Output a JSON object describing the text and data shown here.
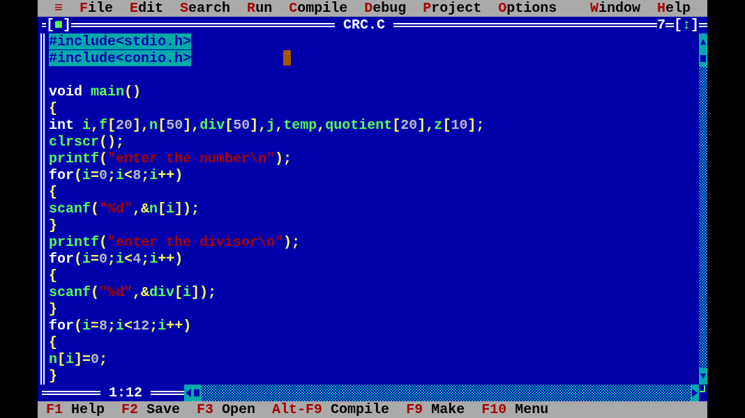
{
  "menu": {
    "items": [
      {
        "label": "≡"
      },
      {
        "label": "File"
      },
      {
        "label": "Edit"
      },
      {
        "label": "Search"
      },
      {
        "label": "Run"
      },
      {
        "label": "Compile"
      },
      {
        "label": "Debug"
      },
      {
        "label": "Project"
      },
      {
        "label": "Options"
      }
    ],
    "right_items": [
      {
        "label": "Window"
      },
      {
        "label": "Help"
      }
    ]
  },
  "window": {
    "close_button": "[■]",
    "title": "CRC.C",
    "number": "7",
    "zoom_button": "[↕]",
    "position": "1:12"
  },
  "editor": {
    "lines": [
      {
        "selected": true,
        "tokens": [
          {
            "kind": "preproc",
            "text": "#include<stdio.h>"
          }
        ]
      },
      {
        "selected": true,
        "tokens": [
          {
            "kind": "preproc",
            "text": "#include<conio.h>"
          }
        ]
      },
      {
        "selected": false
      },
      {
        "selected": false,
        "tokens": [
          {
            "kind": "keyword",
            "text": "void "
          },
          {
            "kind": "ident",
            "text": "main"
          },
          {
            "kind": "punct",
            "text": "()"
          }
        ]
      },
      {
        "selected": false,
        "tokens": [
          {
            "kind": "punct",
            "text": "{"
          }
        ]
      },
      {
        "selected": false,
        "tokens": [
          {
            "kind": "keyword",
            "text": "int "
          },
          {
            "kind": "ident",
            "text": "i"
          },
          {
            "kind": "punct",
            "text": ","
          },
          {
            "kind": "ident",
            "text": "f"
          },
          {
            "kind": "punct",
            "text": "["
          },
          {
            "kind": "number",
            "text": "20"
          },
          {
            "kind": "punct",
            "text": "],"
          },
          {
            "kind": "ident",
            "text": "n"
          },
          {
            "kind": "punct",
            "text": "["
          },
          {
            "kind": "number",
            "text": "50"
          },
          {
            "kind": "punct",
            "text": "],"
          },
          {
            "kind": "ident",
            "text": "div"
          },
          {
            "kind": "punct",
            "text": "["
          },
          {
            "kind": "number",
            "text": "50"
          },
          {
            "kind": "punct",
            "text": "],"
          },
          {
            "kind": "ident",
            "text": "j"
          },
          {
            "kind": "punct",
            "text": ","
          },
          {
            "kind": "ident",
            "text": "temp"
          },
          {
            "kind": "punct",
            "text": ","
          },
          {
            "kind": "ident",
            "text": "quotient"
          },
          {
            "kind": "punct",
            "text": "["
          },
          {
            "kind": "number",
            "text": "20"
          },
          {
            "kind": "punct",
            "text": "],"
          },
          {
            "kind": "ident",
            "text": "z"
          },
          {
            "kind": "punct",
            "text": "["
          },
          {
            "kind": "number",
            "text": "10"
          },
          {
            "kind": "punct",
            "text": "];"
          }
        ]
      },
      {
        "selected": false,
        "tokens": [
          {
            "kind": "ident",
            "text": "clrscr"
          },
          {
            "kind": "punct",
            "text": "();"
          }
        ]
      },
      {
        "selected": false,
        "tokens": [
          {
            "kind": "ident",
            "text": "printf"
          },
          {
            "kind": "punct",
            "text": "("
          },
          {
            "kind": "string",
            "text": "\"enter the number\\n\""
          },
          {
            "kind": "punct",
            "text": ");"
          }
        ]
      },
      {
        "selected": false,
        "tokens": [
          {
            "kind": "keyword",
            "text": "for"
          },
          {
            "kind": "punct",
            "text": "("
          },
          {
            "kind": "ident",
            "text": "i"
          },
          {
            "kind": "punct",
            "text": "="
          },
          {
            "kind": "number",
            "text": "0"
          },
          {
            "kind": "punct",
            "text": ";"
          },
          {
            "kind": "ident",
            "text": "i"
          },
          {
            "kind": "punct",
            "text": "<"
          },
          {
            "kind": "number",
            "text": "8"
          },
          {
            "kind": "punct",
            "text": ";"
          },
          {
            "kind": "ident",
            "text": "i"
          },
          {
            "kind": "punct",
            "text": "++)"
          }
        ]
      },
      {
        "selected": false,
        "tokens": [
          {
            "kind": "punct",
            "text": "{"
          }
        ]
      },
      {
        "selected": false,
        "tokens": [
          {
            "kind": "ident",
            "text": "scanf"
          },
          {
            "kind": "punct",
            "text": "("
          },
          {
            "kind": "string",
            "text": "\"%d\""
          },
          {
            "kind": "punct",
            "text": ",&"
          },
          {
            "kind": "ident",
            "text": "n"
          },
          {
            "kind": "punct",
            "text": "["
          },
          {
            "kind": "ident",
            "text": "i"
          },
          {
            "kind": "punct",
            "text": "]);"
          }
        ]
      },
      {
        "selected": false,
        "tokens": [
          {
            "kind": "punct",
            "text": "}"
          }
        ]
      },
      {
        "selected": false,
        "tokens": [
          {
            "kind": "ident",
            "text": "printf"
          },
          {
            "kind": "punct",
            "text": "("
          },
          {
            "kind": "string",
            "text": "\"enter the divisor\\n\""
          },
          {
            "kind": "punct",
            "text": ");"
          }
        ]
      },
      {
        "selected": false,
        "tokens": [
          {
            "kind": "keyword",
            "text": "for"
          },
          {
            "kind": "punct",
            "text": "("
          },
          {
            "kind": "ident",
            "text": "i"
          },
          {
            "kind": "punct",
            "text": "="
          },
          {
            "kind": "number",
            "text": "0"
          },
          {
            "kind": "punct",
            "text": ";"
          },
          {
            "kind": "ident",
            "text": "i"
          },
          {
            "kind": "punct",
            "text": "<"
          },
          {
            "kind": "number",
            "text": "4"
          },
          {
            "kind": "punct",
            "text": ";"
          },
          {
            "kind": "ident",
            "text": "i"
          },
          {
            "kind": "punct",
            "text": "++)"
          }
        ]
      },
      {
        "selected": false,
        "tokens": [
          {
            "kind": "punct",
            "text": "{"
          }
        ]
      },
      {
        "selected": false,
        "tokens": [
          {
            "kind": "ident",
            "text": "scanf"
          },
          {
            "kind": "punct",
            "text": "("
          },
          {
            "kind": "string",
            "text": "\"%d\""
          },
          {
            "kind": "punct",
            "text": ",&"
          },
          {
            "kind": "ident",
            "text": "div"
          },
          {
            "kind": "punct",
            "text": "["
          },
          {
            "kind": "ident",
            "text": "i"
          },
          {
            "kind": "punct",
            "text": "]);"
          }
        ]
      },
      {
        "selected": false,
        "tokens": [
          {
            "kind": "punct",
            "text": "}"
          }
        ]
      },
      {
        "selected": false,
        "tokens": [
          {
            "kind": "keyword",
            "text": "for"
          },
          {
            "kind": "punct",
            "text": "("
          },
          {
            "kind": "ident",
            "text": "i"
          },
          {
            "kind": "punct",
            "text": "="
          },
          {
            "kind": "number",
            "text": "8"
          },
          {
            "kind": "punct",
            "text": ";"
          },
          {
            "kind": "ident",
            "text": "i"
          },
          {
            "kind": "punct",
            "text": "<"
          },
          {
            "kind": "number",
            "text": "12"
          },
          {
            "kind": "punct",
            "text": ";"
          },
          {
            "kind": "ident",
            "text": "i"
          },
          {
            "kind": "punct",
            "text": "++)"
          }
        ]
      },
      {
        "selected": false,
        "tokens": [
          {
            "kind": "punct",
            "text": "{"
          }
        ]
      },
      {
        "selected": false,
        "tokens": [
          {
            "kind": "ident",
            "text": "n"
          },
          {
            "kind": "punct",
            "text": "["
          },
          {
            "kind": "ident",
            "text": "i"
          },
          {
            "kind": "punct",
            "text": "]="
          },
          {
            "kind": "number",
            "text": "0"
          },
          {
            "kind": "punct",
            "text": ";"
          }
        ]
      },
      {
        "selected": false,
        "tokens": [
          {
            "kind": "punct",
            "text": "}"
          }
        ]
      }
    ]
  },
  "status_bar": [
    {
      "key": "F1",
      "label": "Help"
    },
    {
      "key": "F2",
      "label": "Save"
    },
    {
      "key": "F3",
      "label": "Open"
    },
    {
      "key": "Alt-F9",
      "label": "Compile"
    },
    {
      "key": "F9",
      "label": "Make"
    },
    {
      "key": "F10",
      "label": "Menu"
    }
  ]
}
